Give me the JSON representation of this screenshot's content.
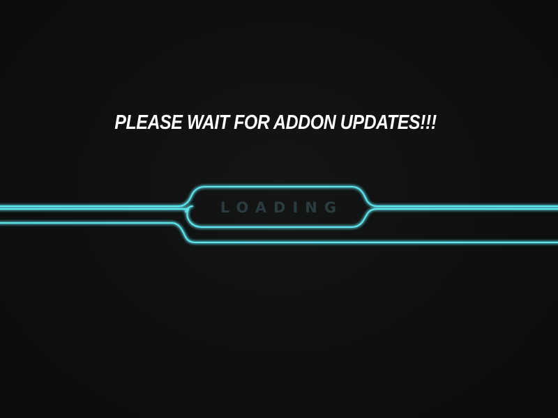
{
  "screen": {
    "headline": "PLEASE WAIT FOR ADDON UPDATES!!!",
    "status_label": "LOADING"
  },
  "colors": {
    "background": "#0d0e0e",
    "headline": "#ffffff",
    "glow_line": "#5fe6ee",
    "status_text": "#2a3c40"
  }
}
